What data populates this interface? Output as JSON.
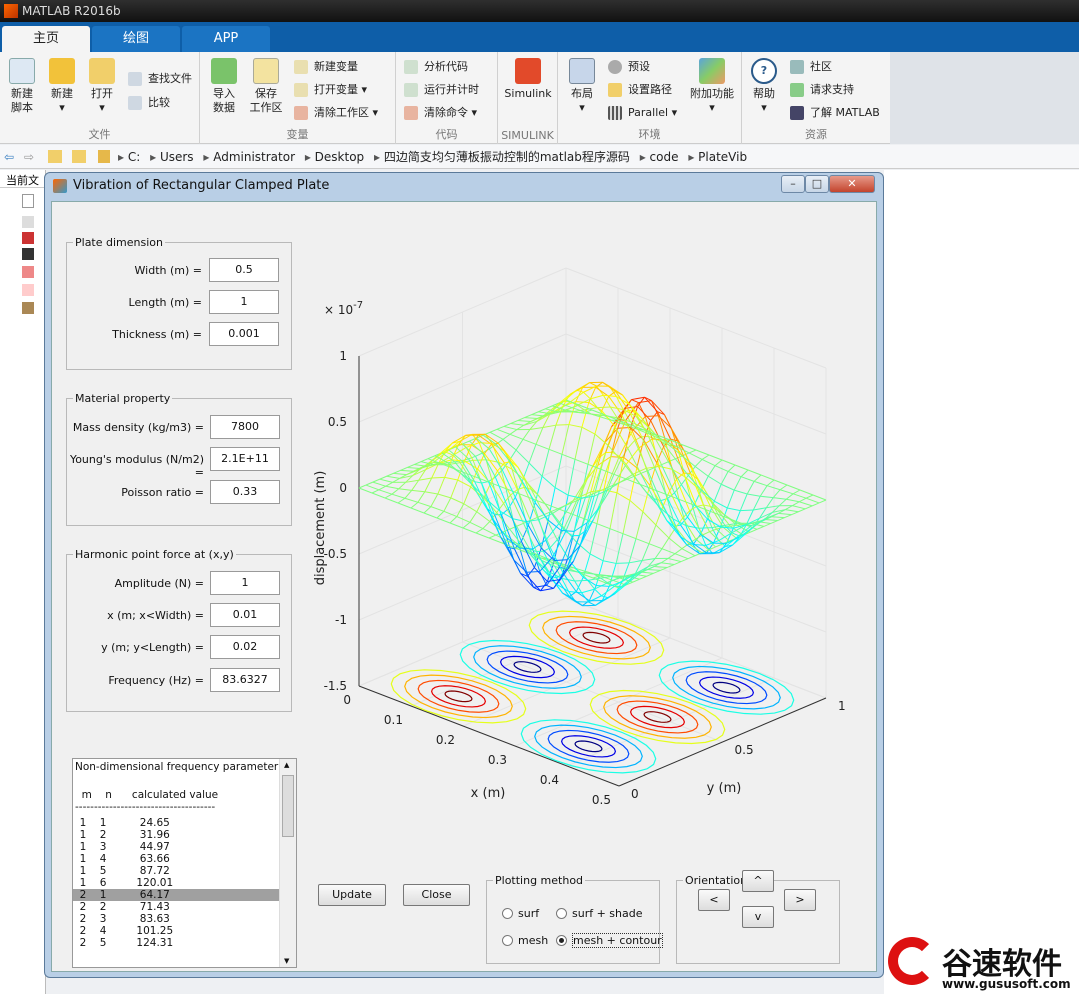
{
  "app_title": "MATLAB R2016b",
  "tabs": [
    "主页",
    "绘图",
    "APP"
  ],
  "ribbon": {
    "new_script": "新建\n脚本",
    "new": "新建",
    "open": "打开",
    "find_files": "查找文件",
    "compare": "比较",
    "file_group": "文件",
    "import_data": "导入\n数据",
    "save_workspace": "保存\n工作区",
    "new_variable": "新建变量",
    "open_variable": "打开变量",
    "clear_workspace": "清除工作区",
    "variable_group": "变量",
    "analyze_code": "分析代码",
    "run_and_time": "运行并计时",
    "clear_commands": "清除命令",
    "code_group": "代码",
    "simulink": "Simulink",
    "simulink_group": "SIMULINK",
    "layout": "布局",
    "preferences": "预设",
    "set_path": "设置路径",
    "parallel": "Parallel",
    "addons": "附加功能",
    "env_group": "环境",
    "help": "帮助",
    "community": "社区",
    "request_support": "请求支持",
    "learn_matlab": "了解 MATLAB",
    "resources_group": "资源"
  },
  "address": {
    "crumbs": [
      "C:",
      "Users",
      "Administrator",
      "Desktop",
      "四边简支均匀薄板振动控制的matlab程序源码",
      "code",
      "PlateVib"
    ]
  },
  "left_panel_title": "当前文",
  "window_title": "Vibration of Rectangular Clamped Plate",
  "plate": {
    "title": "Plate dimension",
    "width_label": "Width (m) =",
    "width": "0.5",
    "length_label": "Length (m) =",
    "length": "1",
    "thickness_label": "Thickness (m) =",
    "thickness": "0.001"
  },
  "material": {
    "title": "Material property",
    "density_label": "Mass density (kg/m3) =",
    "density": "7800",
    "young_label": "Young's modulus (N/m2) =",
    "young": "2.1E+11",
    "poisson_label": "Poisson ratio =",
    "poisson": "0.33"
  },
  "force": {
    "title": "Harmonic point force at (x,y)",
    "amp_label": "Amplitude (N) =",
    "amp": "1",
    "x_label": "x (m; x<Width) =",
    "x": "0.01",
    "y_label": "y (m; y<Length) =",
    "y": "0.02",
    "freq_label": "Frequency (Hz) =",
    "freq": "83.6327"
  },
  "freq_list": {
    "header1": "Non-dimensional frequency parameter",
    "header2": "  m    n      calculated value",
    "divider": "-----------------------------------------------",
    "rows": [
      "  1    1          24.65",
      "  1    2          31.96",
      "  1    3          44.97",
      "  1    4          63.66",
      "  1    5          87.72",
      "  1    6         120.01",
      "  2    1          64.17",
      "  2    2          71.43",
      "  2    3          83.63",
      "  2    4         101.25",
      "  2    5         124.31"
    ],
    "selected": 6
  },
  "buttons": {
    "update": "Update",
    "close": "Close"
  },
  "plotting": {
    "title": "Plotting method",
    "surf": "surf",
    "surf_shade": "surf + shade",
    "mesh": "mesh",
    "mesh_contour": "mesh + contour",
    "selected": "mesh + contour"
  },
  "orientation": {
    "title": "Orientation",
    "up": "^",
    "left": "<",
    "right": ">",
    "down": "v"
  },
  "plot": {
    "zlabel": "displacement (m)",
    "xlabel": "x (m)",
    "ylabel": "y (m)",
    "exponent": "× 10",
    "exponent_power": "-7",
    "zticks": [
      "1",
      "0.5",
      "0",
      "-0.5",
      "-1",
      "-1.5"
    ],
    "xticks": [
      "0",
      "0.1",
      "0.2",
      "0.3",
      "0.4",
      "0.5"
    ],
    "yticks": [
      "0",
      "0.5",
      "1"
    ]
  },
  "brand": {
    "name": "谷速软件",
    "url": "www.gususoft.com"
  },
  "colors": {
    "accent": "#0e5ea8",
    "selected_row": "#a0a0a0"
  }
}
